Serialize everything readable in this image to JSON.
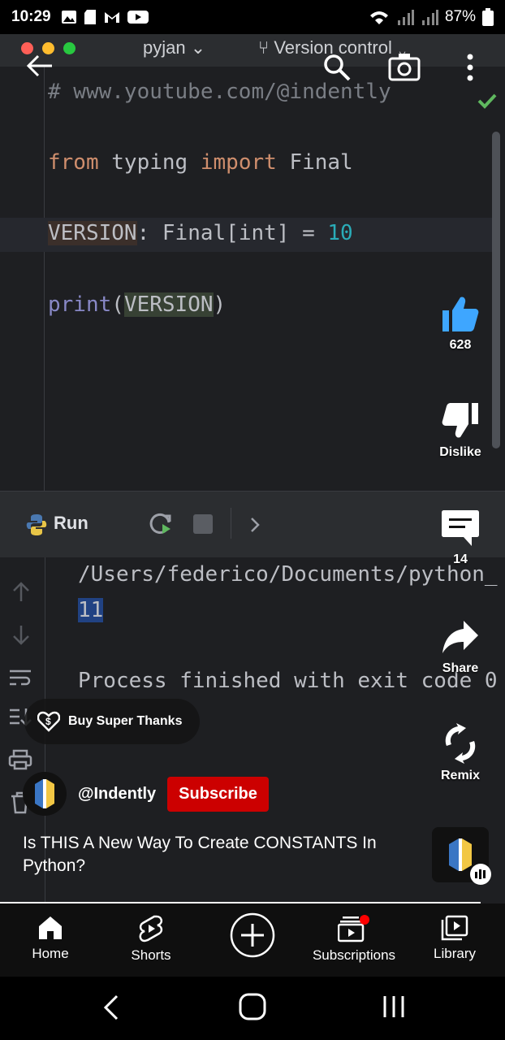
{
  "status_bar": {
    "time": "10:29",
    "battery": "87%"
  },
  "editor": {
    "project": "pyjan",
    "vcs": "Version control",
    "lines": {
      "comment": "# www.youtube.com/@indently",
      "kw_from": "from",
      "mod": "typing",
      "kw_import": "import",
      "name": "Final",
      "var": "VERSION",
      "colon_type": ": Final[",
      "type_int": "int",
      "close_eq": "] = ",
      "value": "10",
      "print_fn": "print",
      "open": "(",
      "arg": "VERSION",
      "close": ")"
    },
    "run_label": "Run",
    "console_path": "/Users/federico/Documents/python_",
    "console_output": "11",
    "console_exit": "Process finished with exit code 0"
  },
  "actions": {
    "like_count": "628",
    "dislike_label": "Dislike",
    "comments_count": "14",
    "share_label": "Share",
    "remix_label": "Remix"
  },
  "super_thanks": "Buy Super Thanks",
  "channel": {
    "handle": "@Indently",
    "subscribe_label": "Subscribe"
  },
  "video_title": "Is THIS A New Way To Create CONSTANTS In Python?",
  "nav": {
    "home": "Home",
    "shorts": "Shorts",
    "subscriptions": "Subscriptions",
    "library": "Library"
  },
  "colors": {
    "subscribe": "#cc0000",
    "like": "#3ea6ff",
    "badge": "#ff0000"
  }
}
